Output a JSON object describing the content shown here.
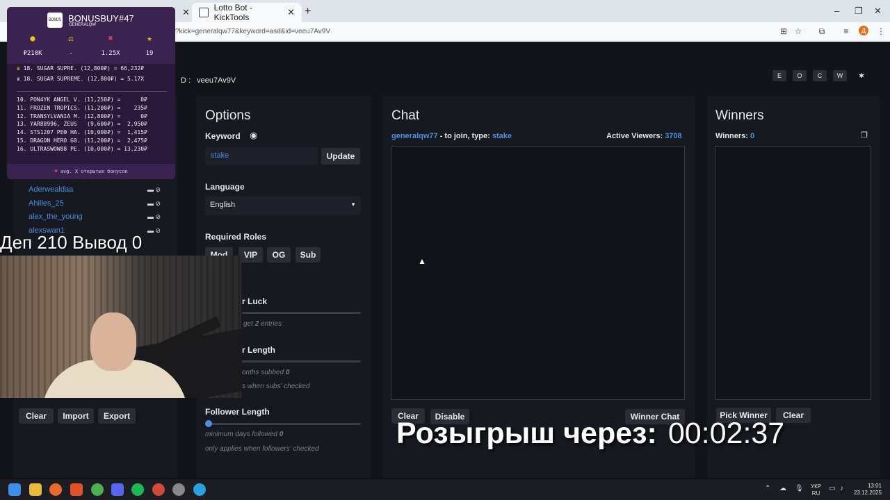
{
  "browser": {
    "tab_active_title": "Lotto Bot - KickTools",
    "url": "?kick=generalqw77&keyword=asd&id=veeu7Av9V",
    "new_tab": "+",
    "close": "✕",
    "profile_letter": "Д"
  },
  "header": {
    "id_label": "D :",
    "id_value": "veeu7Av9V",
    "pills": [
      "E",
      "O",
      "C",
      "W",
      "✱"
    ]
  },
  "options": {
    "title": "Options",
    "keyword_label": "Keyword",
    "keyword_value": "stake",
    "update_button": "Update",
    "language_label": "Language",
    "language_value": "English",
    "roles_label": "Required Roles",
    "roles": [
      "Mod",
      "VIP",
      "OG",
      "Sub"
    ],
    "luck_label": "r Luck",
    "luck_note_prefix": "get",
    "luck_note_value": "2",
    "luck_note_suffix": "entries",
    "sub_length_label": "r Length",
    "sub_note_prefix": "onths subbed",
    "sub_note_value": "0",
    "sub_note2": "s when subs' checked",
    "follower_label": "Follower Length",
    "follower_note_prefix": "minimum days followed",
    "follower_note_value": "0",
    "follower_note2": "only applies when followers' checked"
  },
  "chat": {
    "title": "Chat",
    "channel": "generalqw77",
    "join_text": "- to join, type:",
    "keyword": "stake",
    "viewers_label": "Active Viewers:",
    "viewers_value": "3708",
    "clear_button": "Clear",
    "disable_button": "Disable",
    "winner_chat_button": "Winner Chat"
  },
  "winners": {
    "title": "Winners",
    "count_label": "Winners:",
    "count_value": "0",
    "pick_button": "Pick Winner",
    "clear_button": "Clear"
  },
  "users": {
    "list": [
      "Aderwealdaa",
      "Ahilles_25",
      "alex_the_young",
      "alexswan1"
    ],
    "clear_button": "Clear",
    "import_button": "Import",
    "export_button": "Export"
  },
  "bonus_overlay": {
    "title": "BONUSBUY#47",
    "subtitle": "GENERALQW",
    "logo_text": "BONUS",
    "stats": [
      "₽210K",
      "-",
      "1.25X",
      "19"
    ],
    "best_lines": [
      "18. SUGAR SUPRE. (12,800₽) = 66,232₽",
      "18. SUGAR SUPREME. (12,800₽) = 5.17X"
    ],
    "list_lines": [
      "10. PON4YK ANGEL V. (11,250₽) =      0₽",
      "11. FROZEN TROPICS. (11,200₽) =    235₽",
      "12. TRANSYLVANIA M. (12,800₽) =      0₽",
      "13. YAR88996, ZEUS   (9,600₽) =  2,950₽",
      "14. STS1207 РЕФ НА. (10,000₽) =  1,415₽",
      "15. DRAGON HERO G0. (11,200₽) =  2,475₽",
      "16. ULTRASWOW88 PE. (10,000₽) = 13,230₽"
    ],
    "footer": "avg. X открытых бонусок"
  },
  "stream_overlay": {
    "dep_text": "Деп 210 Вывод 0",
    "raffle_label": "Розыгрыш через:",
    "raffle_timer": "00:02:37"
  },
  "taskbar": {
    "lang_top": "УКР",
    "lang_bottom": "RU",
    "time": "13:01",
    "date": "23.12.2025"
  }
}
